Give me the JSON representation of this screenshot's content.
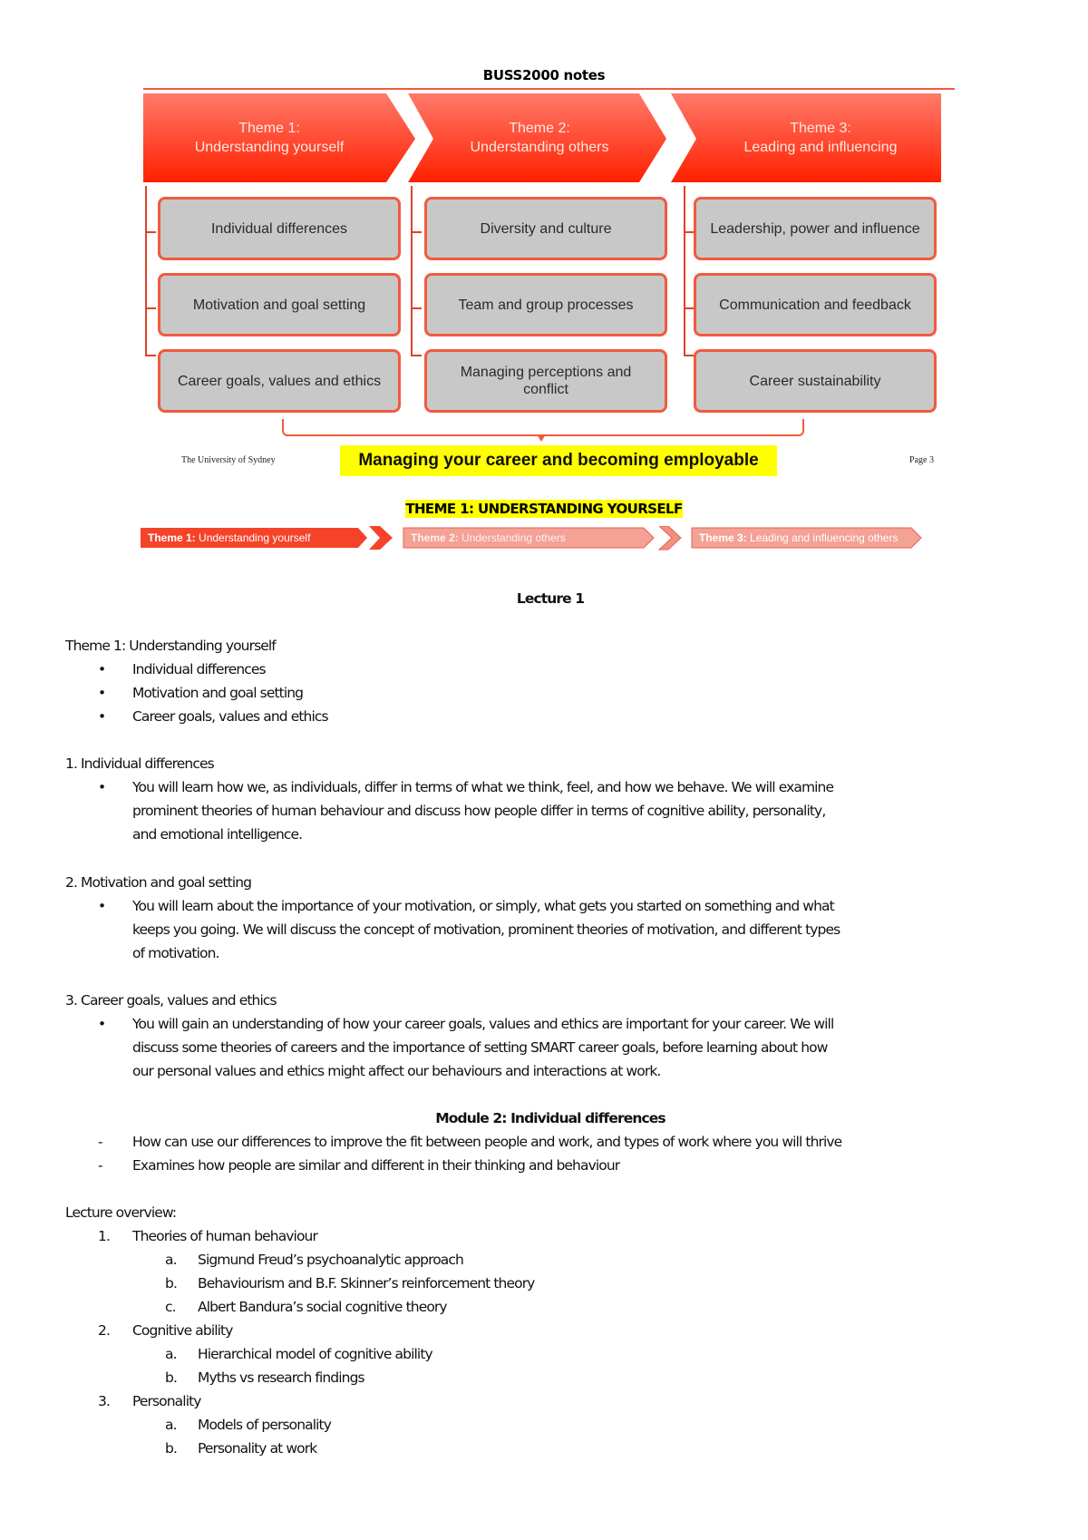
{
  "document": {
    "title": "BUSS2000 notes"
  },
  "diagram": {
    "themes": [
      {
        "line1": "Theme 1:",
        "line2": "Understanding yourself",
        "topics": [
          "Individual differences",
          "Motivation and goal setting",
          "Career goals, values and ethics"
        ]
      },
      {
        "line1": "Theme 2:",
        "line2": "Understanding others",
        "topics": [
          "Diversity and culture",
          "Team and group processes",
          "Managing perceptions and conflict"
        ]
      },
      {
        "line1": "Theme 3:",
        "line2": "Leading and influencing",
        "topics": [
          "Leadership, power and influence",
          "Communication and feedback",
          "Career sustainability"
        ]
      }
    ],
    "banner": "Managing your career and becoming employable",
    "footer_left": "The University of Sydney",
    "footer_right": "Page 3",
    "colors": {
      "accent": "#f25a3f",
      "header_red": "#ff2a10",
      "box_gray": "#c8c8c8",
      "highlight": "#ffff00"
    }
  },
  "theme_heading": "THEME 1: UNDERSTANDING YOURSELF",
  "arrow_strip": [
    {
      "bold": "Theme 1:",
      "rest": " Understanding yourself",
      "active": true
    },
    {
      "bold": "Theme 2:",
      "rest": " Understanding others",
      "active": false
    },
    {
      "bold": "Theme 3:",
      "rest": " Leading and influencing others",
      "active": false
    }
  ],
  "lecture": {
    "heading": "Lecture 1",
    "theme_line": "Theme 1: Understanding yourself",
    "theme_bullets": [
      "Individual differences",
      "Motivation and goal setting",
      "Career goals, values and ethics"
    ],
    "sections": [
      {
        "title": "1. Individual differences",
        "lines": [
          "You will learn how we, as individuals, differ in terms of what we think, feel, and how we behave. We will examine",
          "prominent theories of human behaviour and discuss how people differ in terms of cognitive ability, personality,",
          "and emotional intelligence."
        ]
      },
      {
        "title": "2. Motivation and goal setting",
        "lines": [
          "You will learn about the importance of your motivation, or simply, what gets you started on something and what",
          "keeps you going. We will discuss the concept of motivation, prominent theories of motivation, and different types",
          "of motivation."
        ]
      },
      {
        "title": "3. Career goals, values and ethics",
        "lines": [
          "You will gain an understanding of how your career goals, values and ethics are important for your career. We will",
          "discuss some theories of careers and the importance of setting SMART career goals, before learning about how",
          "our personal values and ethics might affect our behaviours and interactions at work."
        ]
      }
    ]
  },
  "module": {
    "heading": "Module 2: Individual differences",
    "dashes": [
      "How can use our differences to improve the fit between people and work, and types of work where you will thrive",
      "Examines how people are similar and different in their thinking and behaviour"
    ]
  },
  "overview": {
    "label": "Lecture overview:",
    "items": [
      {
        "num": "1.",
        "text": "Theories of human behaviour",
        "sub": [
          {
            "l": "a.",
            "t": "Sigmund Freud’s psychoanalytic approach"
          },
          {
            "l": "b.",
            "t": "Behaviourism and B.F. Skinner’s reinforcement theory"
          },
          {
            "l": "c.",
            "t": "Albert Bandura’s social cognitive theory"
          }
        ]
      },
      {
        "num": "2.",
        "text": "Cognitive ability",
        "sub": [
          {
            "l": "a.",
            "t": "Hierarchical model of cognitive ability"
          },
          {
            "l": "b.",
            "t": "Myths vs research findings"
          }
        ]
      },
      {
        "num": "3.",
        "text": "Personality",
        "sub": [
          {
            "l": "a.",
            "t": "Models of personality"
          },
          {
            "l": "b.",
            "t": "Personality at work"
          }
        ]
      }
    ]
  }
}
